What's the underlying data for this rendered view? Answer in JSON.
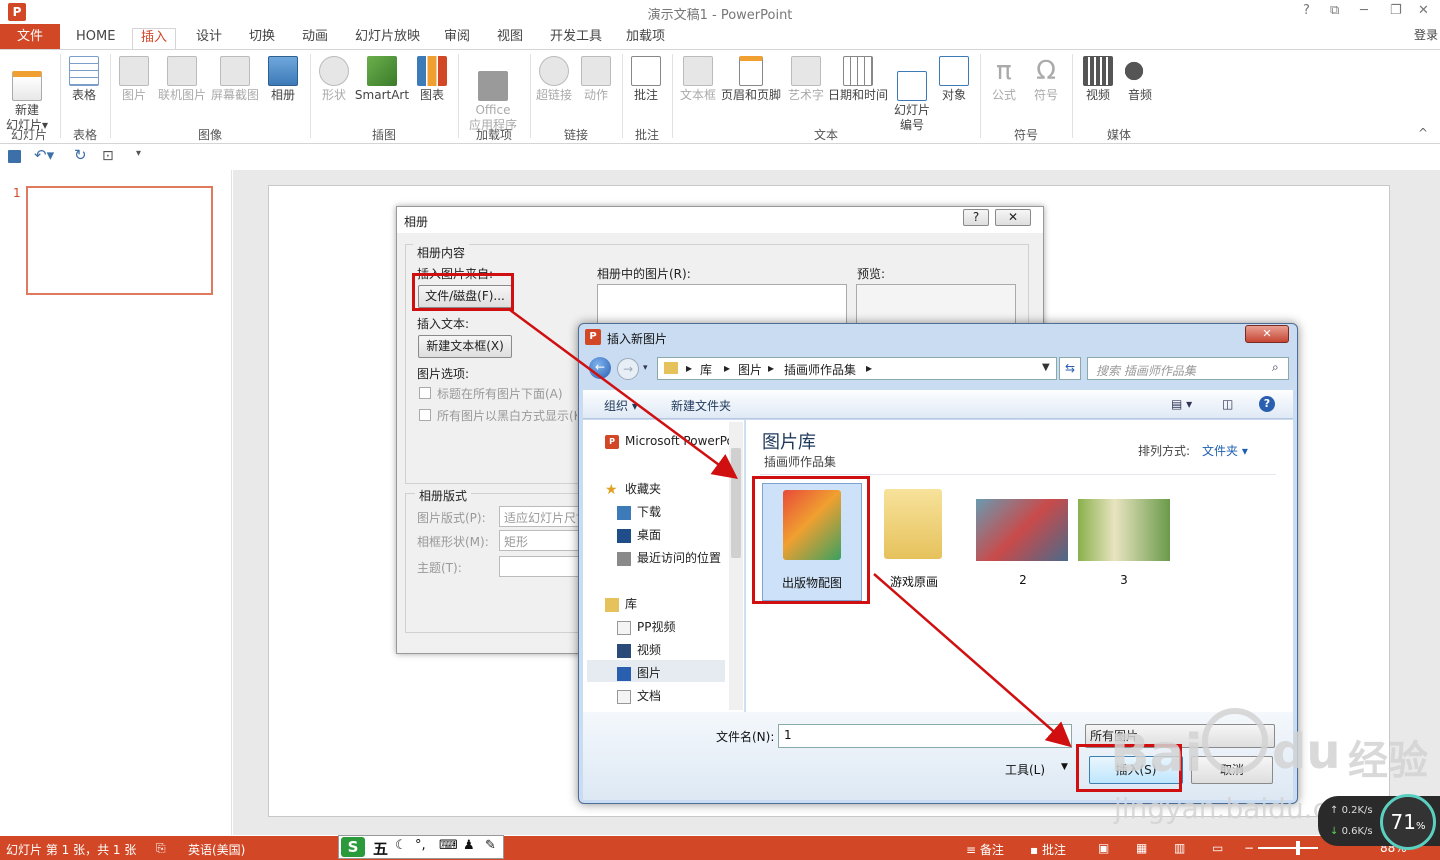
{
  "titlebar": {
    "title": "演示文稿1 - PowerPoint",
    "logo": "P",
    "help": "?",
    "restore": "⧉",
    "minimize": "─",
    "max": "❐",
    "close": "✕",
    "login": "登录"
  },
  "tabs": [
    "HOME",
    "插入",
    "设计",
    "切换",
    "动画",
    "幻灯片放映",
    "审阅",
    "视图",
    "开发工具",
    "加载项"
  ],
  "file_tab": "文件",
  "ribbon": {
    "new_slide": "新建\n幻灯片",
    "new_slide_arrow": "▾",
    "table": "表格",
    "picture": "图片",
    "online_picture": "联机图片",
    "screenshot": "屏幕截图",
    "album": "相册",
    "shapes": "形状",
    "smartart": "SmartArt",
    "chart": "图表",
    "office_apps": "Office\n应用程序",
    "hyperlink": "超链接",
    "action": "动作",
    "comment": "批注",
    "textbox": "文本框",
    "header_footer": "页眉和页脚",
    "wordart": "艺术字",
    "datetime": "日期和时间",
    "slide_number": "幻灯片\n编号",
    "object": "对象",
    "equation": "公式",
    "symbol": "符号",
    "video": "视频",
    "audio": "音频",
    "groups": {
      "slides": "幻灯片",
      "tables": "表格",
      "images": "图像",
      "illustrations": "插图",
      "addins": "加载项",
      "links": "链接",
      "comments": "批注",
      "text": "文本",
      "symbols": "符号",
      "media": "媒体"
    },
    "collapse": "^"
  },
  "thumb": {
    "number": "1"
  },
  "album": {
    "title": "相册",
    "help": "?",
    "close": "✕",
    "content_label": "相册内容",
    "insert_from": "插入图片来自:",
    "file_disk": "文件/磁盘(F)...",
    "insert_text": "插入文本:",
    "new_textbox": "新建文本框(X)",
    "picture_options": "图片选项:",
    "caption_below": "标题在所有图片下面(A)",
    "black_white": "所有图片以黑白方式显示(K)",
    "pictures_in_album": "相册中的图片(R):",
    "preview": "预览:",
    "layout_label": "相册版式",
    "picture_layout": "图片版式(P):",
    "picture_layout_value": "适应幻灯片尺寸",
    "frame_shape": "相框形状(M):",
    "frame_shape_value": "矩形",
    "theme": "主题(T):"
  },
  "insert": {
    "title": "插入新图片",
    "close": "✕",
    "breadcrumb": [
      "库",
      "图片",
      "插画师作品集"
    ],
    "search_placeholder": "搜索 插画师作品集",
    "organize": "组织 ▾",
    "new_folder": "新建文件夹",
    "nav": {
      "app": "Microsoft PowerPoint",
      "favorites": "收藏夹",
      "downloads": "下载",
      "desktop": "桌面",
      "recent": "最近访问的位置",
      "libraries": "库",
      "pp_video": "PP视频",
      "video": "视频",
      "pictures": "图片",
      "documents": "文档"
    },
    "library_title": "图片库",
    "library_sub": "插画师作品集",
    "sort_label": "排列方式:",
    "sort_value": "文件夹 ▾",
    "items": [
      "出版物配图",
      "游戏原画",
      "2",
      "3"
    ],
    "filename_label": "文件名(N):",
    "filename_value": "1",
    "filter": "所有图片",
    "tools": "工具(L)",
    "insert_btn": "插入(S)",
    "cancel": "取消"
  },
  "status": {
    "slide_info": "幻灯片 第 1 张，共 1 张",
    "lang": "英语(美国)",
    "notes": "备注",
    "comments": "批注",
    "zoom": "88%"
  },
  "ime": {
    "label": "五"
  },
  "net": {
    "up": "0.2K/s",
    "down": "0.6K/s",
    "percent": "71",
    "pct_sign": "%"
  },
  "watermark": {
    "brand": "Bai",
    "du": "du",
    "text": "经验",
    "url": "jingyan.baidu.com"
  }
}
